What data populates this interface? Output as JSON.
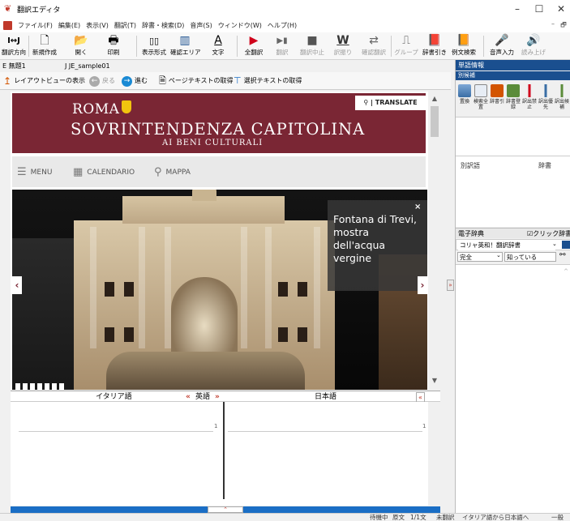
{
  "window": {
    "title": "翻訳エディタ",
    "controls": [
      "–",
      "☐",
      "✕"
    ]
  },
  "menu": {
    "items": [
      "ファイル(F)",
      "編集(E)",
      "表示(V)",
      "翻訳(T)",
      "辞書・検索(D)",
      "音声(S)",
      "ウィンドウ(W)",
      "ヘルプ(H)"
    ],
    "mdi": [
      "–",
      "🗗"
    ]
  },
  "toolbar": {
    "items": [
      {
        "label": "翻訳方向",
        "icon": "I↔J"
      },
      {
        "label": "新規作成",
        "icon": "🗋"
      },
      {
        "label": "開く",
        "icon": "📂"
      },
      {
        "label": "印刷",
        "icon": "🖶"
      },
      {
        "label": "表示形式",
        "icon": "▯▯"
      },
      {
        "label": "確認エリア",
        "icon": "▥"
      },
      {
        "label": "文字",
        "icon": "A"
      },
      {
        "label": "全翻訳",
        "icon": "▶"
      },
      {
        "label": "翻訳",
        "icon": "▶▮"
      },
      {
        "label": "翻訳中止",
        "icon": "■"
      },
      {
        "label": "訳振り",
        "icon": "W"
      },
      {
        "label": "確認翻訳",
        "icon": "⇄"
      },
      {
        "label": "グループ",
        "icon": "⎍"
      },
      {
        "label": "辞書引き",
        "icon": "📕"
      },
      {
        "label": "例文検索",
        "icon": "📙"
      },
      {
        "label": "音声入力",
        "icon": "🎤"
      },
      {
        "label": "読み上げ",
        "icon": "🔊"
      }
    ]
  },
  "tabs": {
    "source": "E 無題1",
    "target": "J JE_sample01"
  },
  "browser_bar": {
    "layout_view": "レイアウトビューの表示",
    "back": "戻る",
    "forward": "進む",
    "get_page_text": "ページテキストの取得",
    "get_selected_text": "選択テキストの取得"
  },
  "webpage": {
    "roma": "ROMA",
    "title": "SOVRINTENDENZA CAPITOLINA",
    "subtitle": "AI BENI CULTURALI",
    "translate": "TRANSLATE",
    "nav": {
      "menu": "MENU",
      "calendario": "CALENDARIO",
      "mappa": "MAPPA"
    },
    "caption": "Fontana di Trevi, mostra dell'acqua vergine",
    "caption_close": "×",
    "prev": "‹",
    "next": "›"
  },
  "lower_pane": {
    "lang_source": "イタリア語",
    "lang_pivot": "英語",
    "lang_target": "日本語",
    "line_left": "1",
    "line_right": "1"
  },
  "status": {
    "items": [
      "待機中",
      "原文",
      "1/1文",
      "未翻訳",
      "イタリア語から日本語へ",
      "一般"
    ]
  },
  "right_panel": {
    "word_info_title": "単語情報",
    "alt_translations_label": "別候補",
    "tools": [
      "置換",
      "検索全置",
      "辞書引",
      "辞書登録",
      "訳出禁止",
      "訳出優先",
      "訳出候補"
    ],
    "col_alt": "別訳語",
    "col_dict": "辞書",
    "e_dict_title": "電子辞典",
    "click_lookup_label": "クリック辞書引",
    "click_lookup_checked": true,
    "dict_select": "コリャ英和！翻訳辞書",
    "match_mode": "完全",
    "search_word": "知っている"
  },
  "colors": {
    "brand_header": "#7a2634",
    "panel_header": "#1a4f8f",
    "splitter": "#1a6ec5"
  }
}
